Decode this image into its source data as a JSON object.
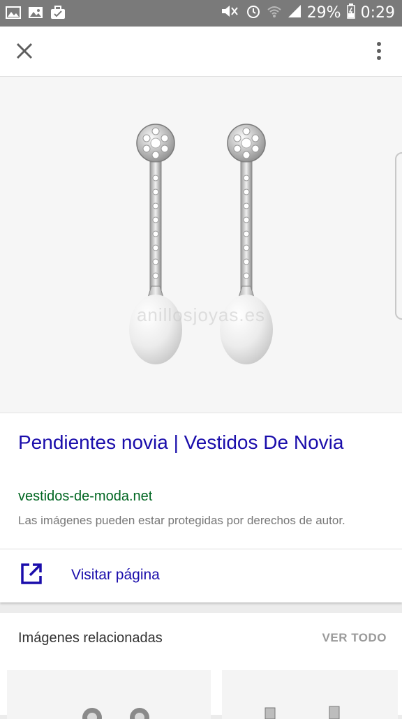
{
  "status_bar": {
    "battery": "29%",
    "time": "0:29",
    "left_icons": [
      "image-icon",
      "image-icon",
      "briefcase-icon"
    ],
    "right_icons": [
      "mute-icon",
      "alarm-icon",
      "wifi-icon",
      "signal-icon",
      "battery-icon"
    ]
  },
  "toolbar": {
    "close_icon": "close-icon",
    "more_icon": "more-vert-icon"
  },
  "image": {
    "watermark": "anillosjoyas.es"
  },
  "result": {
    "title": "Pendientes novia | Vestidos De Novia",
    "domain": "vestidos-de-moda.net",
    "copyright_notice": "Las imágenes pueden estar protegidas por derechos de autor."
  },
  "visit": {
    "label": "Visitar página",
    "icon": "open-in-new-icon"
  },
  "related": {
    "title": "Imágenes relacionadas",
    "see_all": "VER TODO"
  },
  "colors": {
    "link": "#1a0dab",
    "domain": "#006621",
    "status_bar": "#7a7a7a"
  }
}
